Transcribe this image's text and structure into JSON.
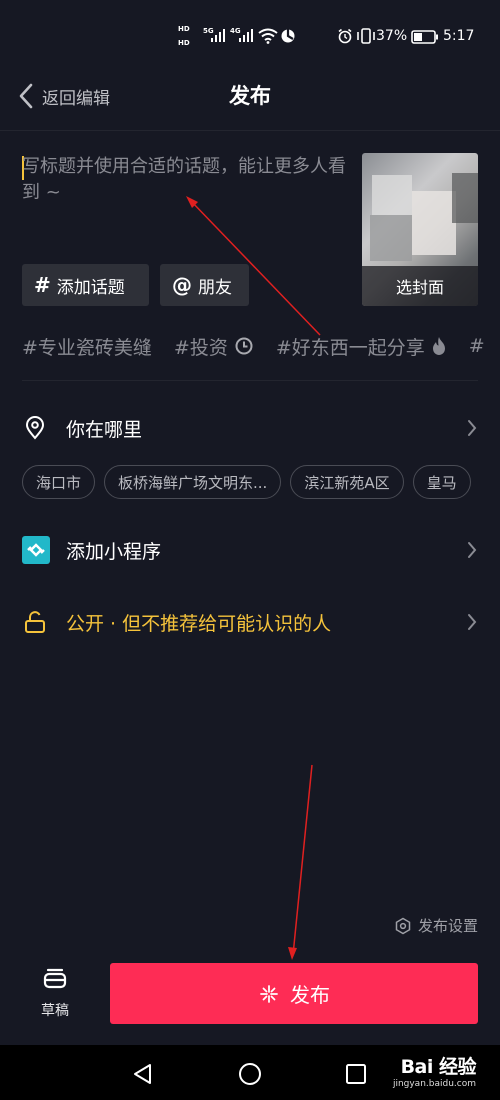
{
  "status_bar": {
    "hd_top": "HD",
    "hd_bottom": "HD",
    "net1": "5G",
    "net2": "4G",
    "battery": "37%",
    "time": "5:17"
  },
  "header": {
    "back_label": "返回编辑",
    "title": "发布"
  },
  "compose": {
    "title_placeholder": "写标题并使用合适的话题，能让更多人看到 ~",
    "cover_label": "选封面",
    "chip_topic": "添加话题",
    "chip_friend": "朋友"
  },
  "suggested_tags": [
    "#专业瓷砖美缝",
    "#投资",
    "#好东西一起分享",
    "#"
  ],
  "location": {
    "label": "你在哪里",
    "chips": [
      "海口市",
      "板桥海鲜广场文明东...",
      "滨江新苑A区",
      "皇马"
    ]
  },
  "mini_program": {
    "label": "添加小程序"
  },
  "privacy": {
    "label": "公开 · 但不推荐给可能认识的人",
    "color": "#f5c33b"
  },
  "footer": {
    "settings_label": "发布设置",
    "drafts_label": "草稿",
    "publish_label": "发布",
    "publish_color": "#fe2c55"
  },
  "watermark": {
    "main": "Bai 经验",
    "sub": "jingyan.baidu.com"
  }
}
